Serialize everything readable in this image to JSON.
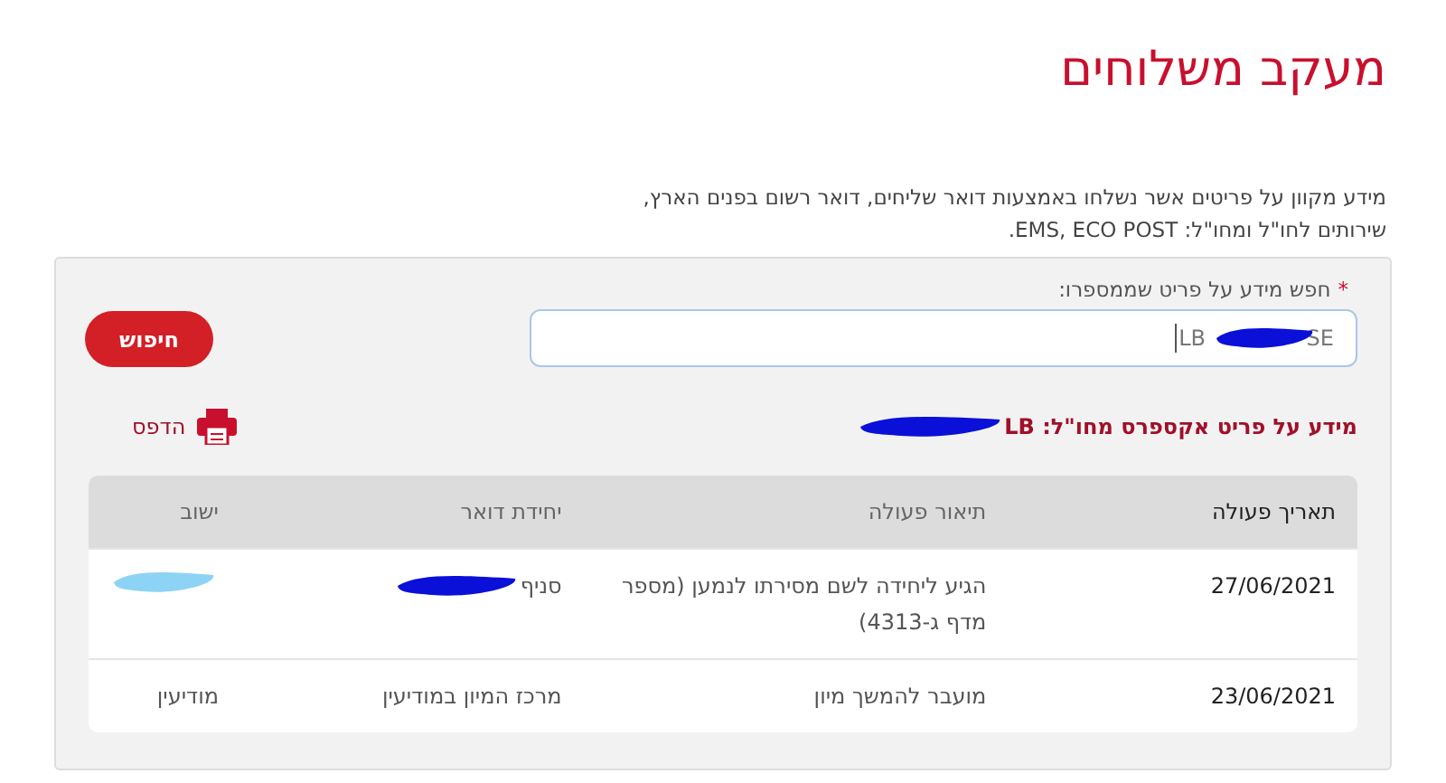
{
  "page_title": "מעקב משלוחים",
  "description": "מידע מקוון על פריטים אשר נשלחו באמצעות דואר שליחים, דואר רשום בפנים הארץ, שירותים לחו\"ל ומחו\"ל: EMS, ECO POST.",
  "search": {
    "label": "חפש מידע על פריט שממספרו:",
    "required_mark": "*",
    "value": "LB SE",
    "redaction": {
      "color": "#0a10d8"
    },
    "button": "חיפוש"
  },
  "result": {
    "heading": "מידע על פריט אקספרס מחו\"ל: LB",
    "redaction": {
      "color": "#0a10d8"
    },
    "print": "הדפס"
  },
  "table": {
    "columns": [
      "תאריך פעולה",
      "תיאור פעולה",
      "יחידת דואר",
      "ישוב"
    ],
    "rows": [
      {
        "cells": [
          {
            "text": "27/06/2021"
          },
          {
            "text": "הגיע ליחידה לשם מסירתו לנמען (מספר מדף ג-4313)"
          },
          {
            "text": "סניף",
            "redaction": {
              "color": "#0a10d8"
            }
          },
          {
            "redaction": {
              "color": "#8dd3f5"
            }
          }
        ]
      },
      {
        "cells": [
          {
            "text": "23/06/2021"
          },
          {
            "text": "מועבר להמשך מיון"
          },
          {
            "text": "מרכז המיון במודיעין"
          },
          {
            "text": "מודיעין"
          }
        ]
      }
    ]
  }
}
